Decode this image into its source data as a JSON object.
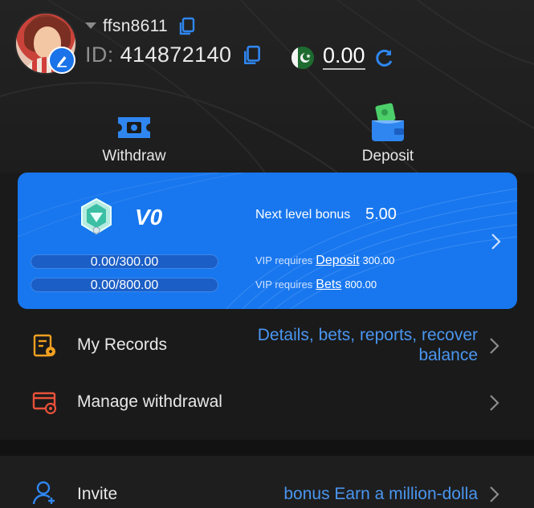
{
  "profile": {
    "username": "ffsn8611",
    "id_label": "ID:",
    "id_value": "414872140",
    "balance": "0.00"
  },
  "actions": [
    {
      "label": "Withdraw",
      "icon": "ticket-icon"
    },
    {
      "label": "Deposit",
      "icon": "wallet-icon"
    }
  ],
  "vip": {
    "level": "V0",
    "next_level_label": "Next level bonus",
    "next_level_value": "5.00",
    "deposit_progress_text": "0.00/300.00",
    "deposit_progress_fraction": 0,
    "bets_progress_text": "0.00/800.00",
    "bets_progress_fraction": 0,
    "deposit_req_label": "VIP requires",
    "deposit_req_link": "Deposit",
    "deposit_req_amount": "300.00",
    "bets_req_label": "VIP requires",
    "bets_req_link": "Bets",
    "bets_req_amount": "800.00"
  },
  "menu": [
    {
      "label": "My Records",
      "detail_line1": "Details, bets, reports, recover",
      "detail_line2": "balance"
    },
    {
      "label": "Manage withdrawal",
      "detail_line1": "",
      "detail_line2": ""
    },
    {
      "label": "Invite",
      "detail_line1": "bonus  Earn a million-dolla",
      "detail_line2": ""
    }
  ],
  "colors": {
    "accent": "#1877ee",
    "link": "#4a96f0",
    "icon_orange": "#f0a020",
    "icon_red": "#e8513a"
  }
}
